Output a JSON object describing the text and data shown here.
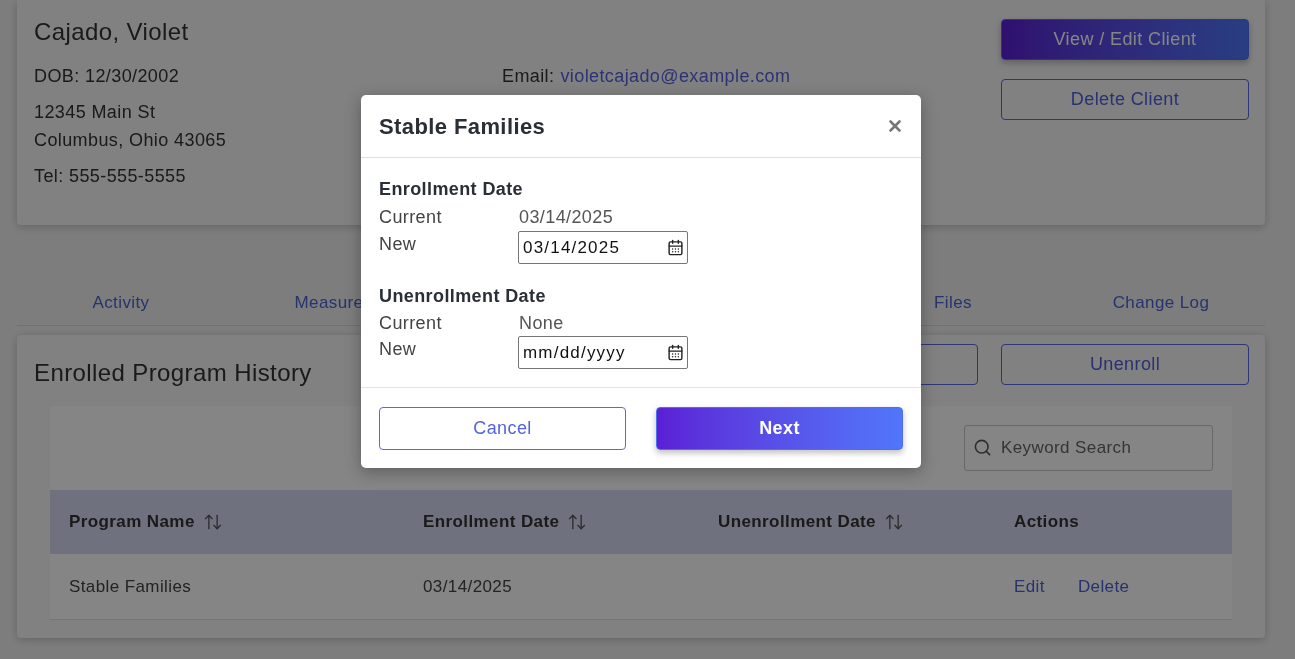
{
  "client": {
    "name": "Cajado, Violet",
    "dob": "DOB: 12/30/2002",
    "address": [
      "12345 Main St",
      "Columbus, Ohio 43065"
    ],
    "tel": "Tel: 555-555-5555",
    "email_label": "Email:",
    "email": "violetcajado@example.com",
    "buttons": [
      {
        "label": "View / Edit Client",
        "kind": "primary"
      },
      {
        "label": "Delete Client",
        "kind": "outline"
      }
    ]
  },
  "tabs": [
    {
      "label": "Activity",
      "selected": false
    },
    {
      "label": "Measure",
      "selected": false
    },
    {
      "label": "Files",
      "selected": false
    },
    {
      "label": "Change Log",
      "selected": false
    }
  ],
  "history": {
    "title": "Enrolled Program History",
    "buttons": [
      {
        "kind": "outline"
      },
      {
        "label": "Unenroll",
        "kind": "outline"
      }
    ],
    "search": {
      "placeholder": "Keyword Search"
    },
    "table": {
      "columns": [
        {
          "label": "Program Name",
          "sortable": true
        },
        {
          "label": "Enrollment Date",
          "sortable": true
        },
        {
          "label": "Unenrollment Date",
          "sortable": true
        },
        {
          "label": "Actions",
          "sortable": false
        }
      ],
      "rows": [
        {
          "program": "Stable Families",
          "enrollment": "03/14/2025",
          "actions": [
            "Edit",
            "Delete"
          ]
        }
      ]
    }
  },
  "modal": {
    "title": "Stable Families",
    "sections": [
      {
        "heading": "Enrollment Date",
        "current_label": "Current",
        "current": "03/14/2025",
        "new_label": "New",
        "value": "03/14/2025"
      },
      {
        "heading": "Unenrollment Date",
        "current_label": "Current",
        "current": "None",
        "new_label": "New",
        "placeholder": "mm/dd/yyyy"
      }
    ],
    "buttons": [
      {
        "label": "Cancel",
        "kind": "outline"
      },
      {
        "label": "Next",
        "kind": "primary"
      }
    ]
  }
}
